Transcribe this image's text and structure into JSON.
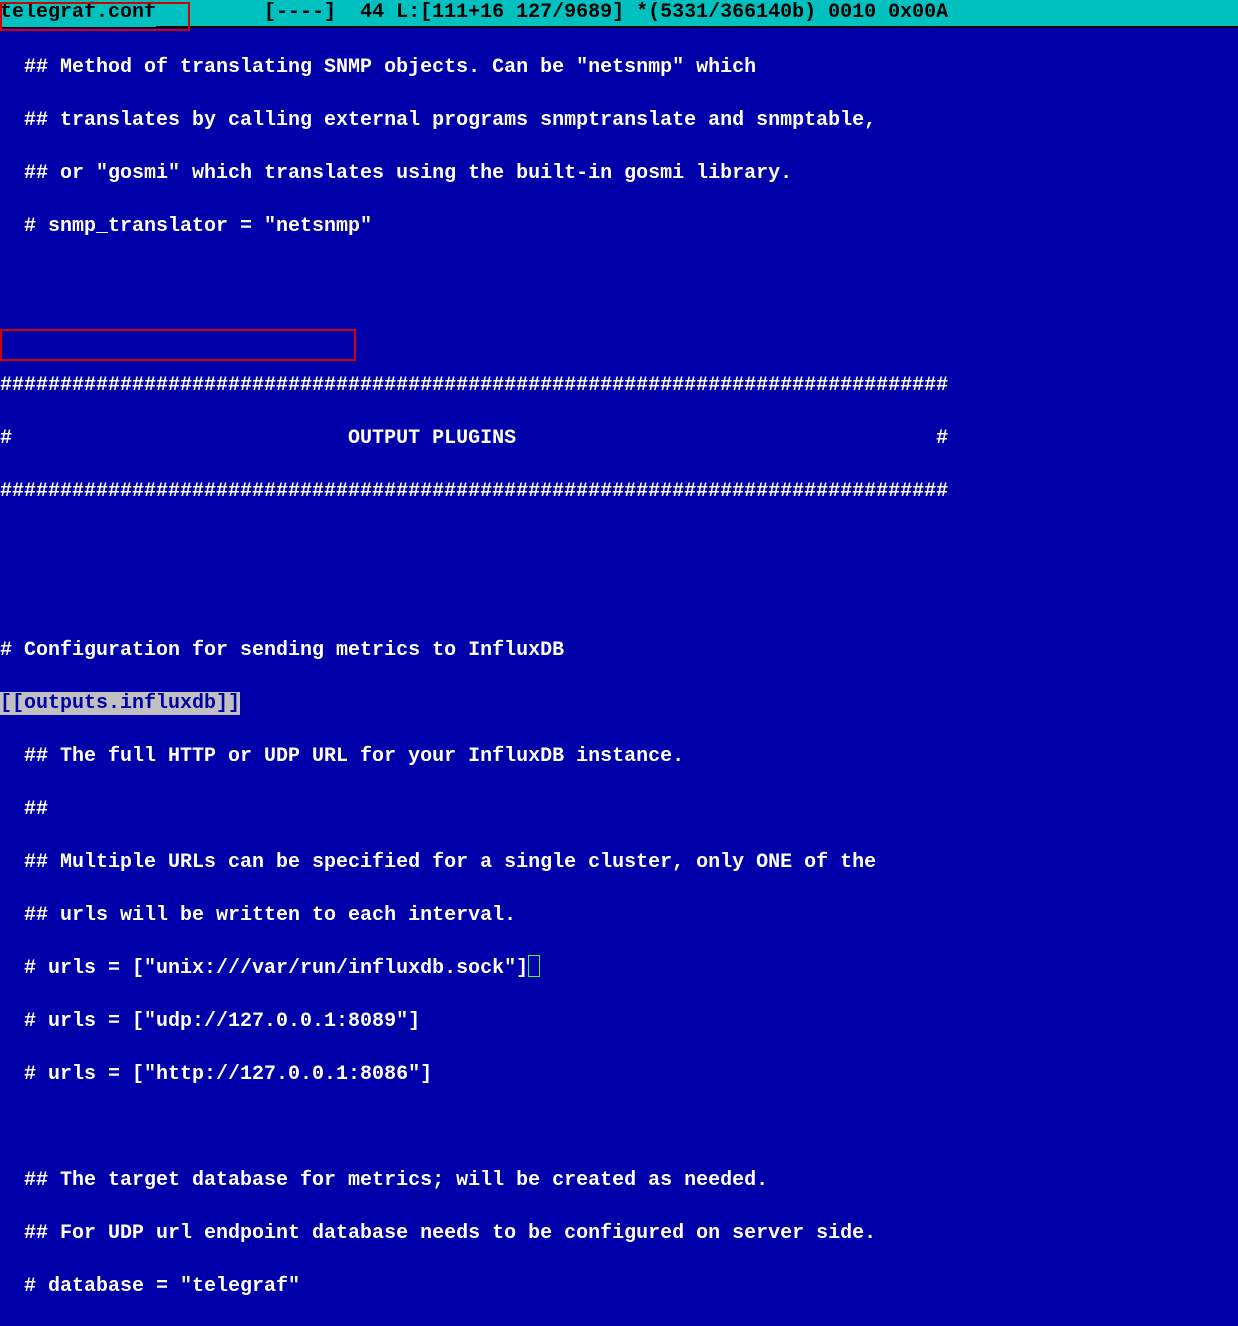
{
  "title": {
    "filename": "telegraf.conf",
    "status": "         [----]  44 L:[111+16 127/9689] *(5331/366140b) 0010 0x00A"
  },
  "lines": {
    "l1": "  ## Method of translating SNMP objects. Can be \"netsnmp\" which",
    "l2": "  ## translates by calling external programs snmptranslate and snmptable,",
    "l3": "  ## or \"gosmi\" which translates using the built-in gosmi library.",
    "l4": "  # snmp_translator = \"netsnmp\"",
    "l5": "",
    "l6": "",
    "l7": "###############################################################################",
    "l8": "#                            OUTPUT PLUGINS                                   #",
    "l9": "###############################################################################",
    "l10": "",
    "l11": "",
    "l12": "# Configuration for sending metrics to InfluxDB",
    "l13a": "[[outputs.influxdb]]",
    "l14": "  ## The full HTTP or UDP URL for your InfluxDB instance.",
    "l15": "  ##",
    "l16": "  ## Multiple URLs can be specified for a single cluster, only ONE of the",
    "l17": "  ## urls will be written to each interval.",
    "l18": "  # urls = [\"unix:///var/run/influxdb.sock\"]",
    "l19": "  # urls = [\"udp://127.0.0.1:8089\"]",
    "l20": "  # urls = [\"http://127.0.0.1:8086\"]",
    "l21": "",
    "l22": "  ## The target database for metrics; will be created as needed.",
    "l23": "  ## For UDP url endpoint database needs to be configured on server side.",
    "l24": "  # database = \"telegraf\""
  }
}
